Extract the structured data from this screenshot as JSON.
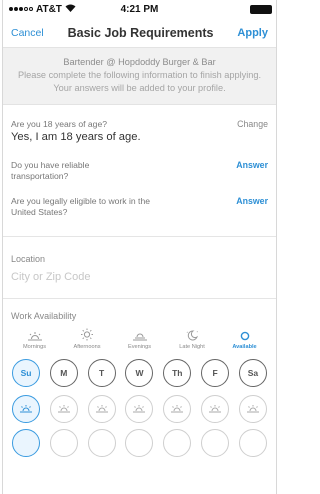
{
  "status_bar": {
    "carrier": "AT&T",
    "time": "4:21 PM"
  },
  "nav": {
    "cancel_label": "Cancel",
    "title": "Basic Job Requirements",
    "apply_label": "Apply"
  },
  "intro": {
    "job": "Bartender @ Hopdoddy Burger & Bar",
    "message": "Please complete the following information to finish applying. Your answers will be added to your profile."
  },
  "questions": [
    {
      "question": "Are you 18 years of age?",
      "answer": "Yes, I am 18 years of age.",
      "action": "Change"
    },
    {
      "question": "Do you have reliable transportation?",
      "action": "Answer"
    },
    {
      "question": "Are you legally eligible to work in the United States?",
      "action": "Answer"
    }
  ],
  "location": {
    "label": "Location",
    "placeholder": "City or Zip Code"
  },
  "availability": {
    "label": "Work Availability",
    "shifts": [
      {
        "label": "Mornings",
        "icon": "sunrise-icon"
      },
      {
        "label": "Afternoons",
        "icon": "sun-icon"
      },
      {
        "label": "Evenings",
        "icon": "sunset-icon"
      },
      {
        "label": "Late Night",
        "icon": "moon-icon"
      },
      {
        "label": "Available",
        "icon": "circle-icon"
      }
    ],
    "days": [
      "Su",
      "M",
      "T",
      "W",
      "Th",
      "F",
      "Sa"
    ]
  },
  "colors": {
    "accent": "#2d8fd5",
    "intro_bg": "#f1f1f1",
    "active_bg": "#eaf5fe"
  }
}
